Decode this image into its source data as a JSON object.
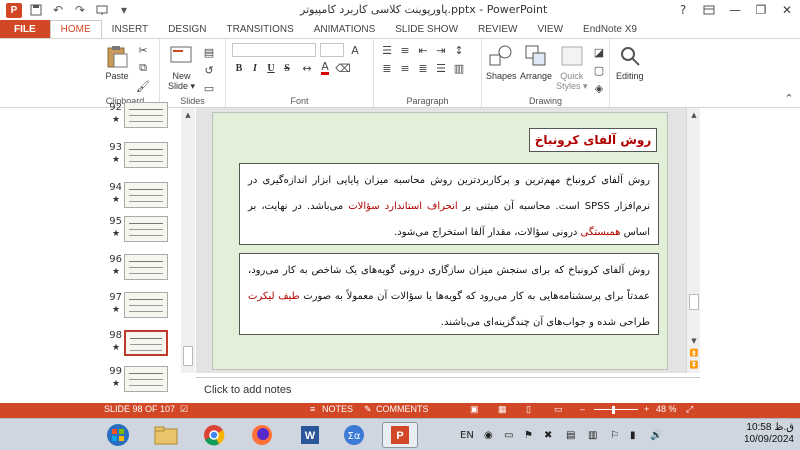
{
  "window": {
    "title": "پاورپوینت کلاسی کاربرد کامپیوتر.pptx - PowerPoint",
    "app_logo": "P",
    "help": "?",
    "minimize": "—",
    "restore": "❐",
    "close": "✕"
  },
  "tabs": [
    {
      "label": "FILE"
    },
    {
      "label": "HOME"
    },
    {
      "label": "INSERT"
    },
    {
      "label": "DESIGN"
    },
    {
      "label": "TRANSITIONS"
    },
    {
      "label": "ANIMATIONS"
    },
    {
      "label": "SLIDE SHOW"
    },
    {
      "label": "REVIEW"
    },
    {
      "label": "VIEW"
    },
    {
      "label": "EndNote X9"
    }
  ],
  "ribbon": {
    "clipboard": {
      "label": "Clipboard",
      "paste": "Paste"
    },
    "slides": {
      "label": "Slides",
      "new_slide": "New",
      "new_slide2": "Slide ▾"
    },
    "font": {
      "label": "Font",
      "bold": "B",
      "italic": "I",
      "underline": "U",
      "strike": "S"
    },
    "paragraph": {
      "label": "Paragraph"
    },
    "drawing": {
      "label": "Drawing",
      "shapes": "Shapes",
      "arrange": "Arrange",
      "quick_styles": "Quick",
      "quick_styles2": "Styles ▾"
    },
    "editing": {
      "label": "Editing"
    }
  },
  "thumbnails": [
    {
      "num": "92",
      "star": "★"
    },
    {
      "num": "93",
      "star": "★"
    },
    {
      "num": "94",
      "star": "★"
    },
    {
      "num": "95",
      "star": "★"
    },
    {
      "num": "96",
      "star": "★"
    },
    {
      "num": "97",
      "star": "★"
    },
    {
      "num": "98",
      "star": "★"
    },
    {
      "num": "99",
      "star": "★"
    }
  ],
  "slide": {
    "title": "روش آلفای کرونباخ",
    "box1": {
      "p1": "روش آلفای کرونباخ مهم‌ترین و پرکاربردترین روش محاسبه میزان پایایی ابزار اندازه‌گیری در نرم‌افزار SPSS است. محاسبه آن مبتنی بر ",
      "red1": "انحراف استاندارد سؤالات",
      "p2": " می‌باشد. در نهایت، بر اساس ",
      "red2": "همبستگی",
      "p3": " درونی سؤالات، مقدار آلفا استخراج می‌شود."
    },
    "box2": {
      "p1": "روش آلفای کرونباخ که برای سنجش میزان سازگاری درونی گویه‌های یک شاخص به کار می‌رود، عمدتاً برای پرسشنامه‌هایی به کار می‌رود که گویه‌ها یا سؤالات آن معمولاً به صورت ",
      "red1": "طیف لیکرت",
      "p2": " طراحی شده و جواب‌های آن چندگزینه‌ای می‌باشند."
    }
  },
  "notes": {
    "placeholder": "Click to add notes"
  },
  "statusbar": {
    "slide_info": "SLIDE 98 OF 107",
    "notes": "NOTES",
    "comments": "COMMENTS",
    "zoom": "48 %",
    "minus": "–",
    "plus": "+"
  },
  "taskbar": {
    "lang": "EN",
    "time_prefix": "ق.ظ",
    "time": "10:58",
    "date": "10/09/2024"
  },
  "colors": {
    "accent": "#d24726",
    "slide_bg": "#e2f0d9",
    "title_text": "#b00000"
  }
}
